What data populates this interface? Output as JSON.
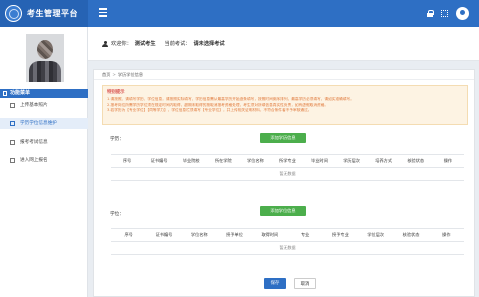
{
  "app": {
    "title": "考生管理平台"
  },
  "colors": {
    "brand": "#2e6fc4",
    "success": "#4cae4c",
    "warning_text": "#e07a3c",
    "danger_text": "#d9534f"
  },
  "topbar": {
    "icons": [
      "lock-icon",
      "fullscreen-icon",
      "user-icon"
    ]
  },
  "sidebar": {
    "header": "功能菜单",
    "items": [
      {
        "label": "上传基本照片",
        "icon": "image-icon",
        "active": false
      },
      {
        "label": "学历学位信息维护",
        "icon": "book-icon",
        "active": true
      },
      {
        "label": "报考考试信息",
        "icon": "edit-icon",
        "active": false
      },
      {
        "label": "进入网上报名",
        "icon": "arrow-right-icon",
        "active": false
      }
    ]
  },
  "welcome": {
    "prefix": "欢迎你：",
    "user": "测试考生",
    "role_prefix": "当前考试：",
    "exam": "请未选择考试"
  },
  "breadcrumb": {
    "home": "首页",
    "current": "学历学位信息"
  },
  "notice": {
    "title": "特别提示",
    "lines": [
      "1.请按照、请填写学历、学位信息，请按照实际填写，学历信息需从最高学历开始逐条填写，按照时间倒序排列，最高学历必须填写，请如实准确填写。",
      "2.报考岗位所需学历学位须在规定时间内取得，超期未取得的按取消报考资格处理，考生须对所填信息真实性负责，如有虚假取消资格。",
      "3.若学历为【专业学位】【同等学力】，学位信息栏须填写【专业学位】，并上传相关证明材料，不符合条件者不予审核通过。"
    ]
  },
  "education": {
    "label": "学历：",
    "add_label": "添加学历信息",
    "columns": [
      "序号",
      "证书编号",
      "毕业院校",
      "所在学院",
      "学位名称",
      "所学专业",
      "毕业时间",
      "学历层次",
      "培养方式",
      "核验状态",
      "操作"
    ],
    "empty": "暂无数据"
  },
  "degree": {
    "label": "学位：",
    "add_label": "添加学位信息",
    "columns": [
      "序号",
      "证书编号",
      "学位名称",
      "授予单位",
      "取得时间",
      "专业",
      "授予专业",
      "学位层次",
      "核验状态",
      "操作"
    ],
    "empty": "暂无数据"
  },
  "footer": {
    "save_label": "保存",
    "cancel_label": "取消"
  }
}
